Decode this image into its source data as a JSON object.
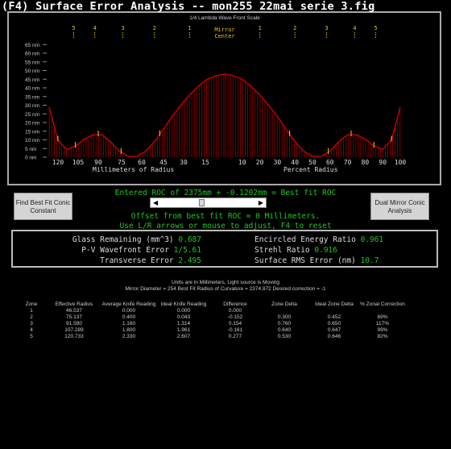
{
  "window": {
    "title": "(F4) Surface Error Analysis -- mon255 22mai serie 3.fig"
  },
  "chart_data": {
    "type": "bar",
    "title": "1/4 Lambda Wave Front Scale",
    "ylabel_unit": "nm",
    "y_ticks": [
      0,
      5,
      10,
      15,
      20,
      25,
      30,
      35,
      40,
      45,
      50,
      55,
      60,
      65
    ],
    "ylim": [
      0,
      65
    ],
    "x_left_label": "Millimeters of Radius",
    "x_right_label": "Percent Radius",
    "x_ticks_mm": [
      "120",
      "105",
      "90",
      "75",
      "60",
      "45",
      "30",
      "15"
    ],
    "x_ticks_percent": [
      "10",
      "20",
      "30",
      "40",
      "50",
      "60",
      "70",
      "80",
      "90",
      "100"
    ],
    "center_label": [
      "Mirror",
      "Center"
    ],
    "zone_markers_left": [
      "5",
      "4",
      "3",
      "2",
      "1"
    ],
    "zone_markers_right": [
      "1",
      "2",
      "3",
      "4",
      "5"
    ],
    "profile_percent": [
      0,
      5,
      10,
      15,
      20,
      25,
      30,
      35,
      40,
      45,
      50,
      55,
      60,
      65,
      70,
      75,
      80,
      85,
      90,
      95,
      100
    ],
    "profile_nm": [
      48,
      47,
      45,
      41,
      36,
      30,
      23.5,
      16,
      9,
      3.5,
      0.5,
      0.5,
      3.5,
      9,
      13,
      13,
      10.5,
      6.5,
      4.5,
      10,
      29
    ],
    "grid": false,
    "bar_color": "#8b0000",
    "curve_color": "#d00000"
  },
  "buttons": {
    "left": "Find Best Fit Conic Constant",
    "right": "Dual Mirror Conic Analysis"
  },
  "roc": {
    "entered": "Entered ROC of 2375mm + -0.1202mm = Best fit ROC",
    "offset": "Offset from best fit ROC = 0 Millimeters.",
    "hint": "Use L/R arrows or mouse to adjust, F4 to reset"
  },
  "stats": {
    "glass_label": "Glass Remaining (mm^3)",
    "glass_value": "0.687",
    "pv_label": "P-V Wavefront Error",
    "pv_value": "1/5.61",
    "transverse_label": "Transverse Error",
    "transverse_value": "2.495",
    "encircled_label": "Encircled Energy Ratio",
    "encircled_value": "0.961",
    "strehl_label": "Strehl Ratio",
    "strehl_value": "0.916",
    "rms_label": "Surface RMS Error (nm)",
    "rms_value": "10.7"
  },
  "info": {
    "line1": "Units are in Millimeters, Light source is Moving",
    "line2": "Mirror Diameter = 254   Best Fit Radius of Curvature = 2374.872   Desired correction = -1"
  },
  "zone_table": {
    "headers": [
      "Zone",
      "Effective Radius",
      "Average Knife Reading",
      "Ideal Knife Reading",
      "Difference",
      "Zone Delta",
      "Ideal Zone Delta",
      "% Zonal Correction"
    ],
    "rows": [
      [
        "1",
        "46.537",
        "0.000",
        "0.000",
        "0.000",
        "",
        "",
        ""
      ],
      [
        "2",
        "75.137",
        "0.400",
        "0.043",
        "-0.152",
        "0.300",
        "0.452",
        "69%"
      ],
      [
        "3",
        "91.590",
        "1.160",
        "1.314",
        "0.154",
        "0.760",
        "0.650",
        "117%"
      ],
      [
        "4",
        "107.289",
        "1.800",
        "1.961",
        "-0.161",
        "0.640",
        "0.647",
        "99%"
      ],
      [
        "5",
        "120.733",
        "2.330",
        "2.607",
        "0.277",
        "0.530",
        "0.646",
        "82%"
      ]
    ]
  }
}
